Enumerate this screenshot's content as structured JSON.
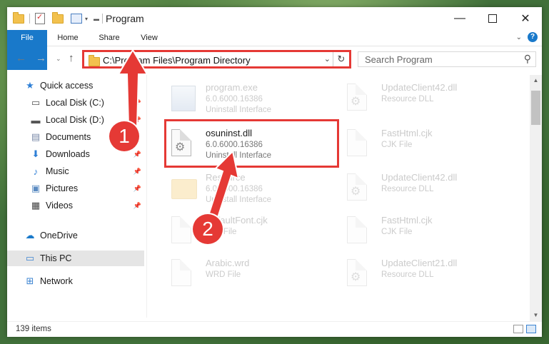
{
  "window": {
    "title": "Program"
  },
  "ribbon": {
    "tabs": [
      "File",
      "Home",
      "Share",
      "View"
    ],
    "help": "?"
  },
  "address": {
    "path": "C:\\Program Files\\Program Directory"
  },
  "search": {
    "placeholder": "Search Program"
  },
  "sidebar": {
    "items": [
      {
        "label": "Quick access",
        "icon": "star-icon"
      },
      {
        "label": "Local Disk (C:)",
        "icon": "drive-icon",
        "pinned": true
      },
      {
        "label": "Local Disk (D:)",
        "icon": "drive-icon",
        "pinned": true
      },
      {
        "label": "Documents",
        "icon": "documents-icon",
        "pinned": true
      },
      {
        "label": "Downloads",
        "icon": "download-icon",
        "pinned": true
      },
      {
        "label": "Music",
        "icon": "music-icon",
        "pinned": true
      },
      {
        "label": "Pictures",
        "icon": "pictures-icon",
        "pinned": true
      },
      {
        "label": "Videos",
        "icon": "videos-icon",
        "pinned": true
      },
      {
        "label": "OneDrive",
        "icon": "cloud-icon"
      },
      {
        "label": "This PC",
        "icon": "monitor-icon",
        "selected": true
      },
      {
        "label": "Network",
        "icon": "network-icon"
      }
    ]
  },
  "files": [
    {
      "name": "program.exe",
      "ver": "6.0.6000.16386",
      "desc": "Uninstall Interface",
      "kind": "exe",
      "faded": true
    },
    {
      "name": "UpdateClient42.dll",
      "ver": "Resource DLL",
      "desc": "",
      "kind": "dll",
      "faded": true
    },
    {
      "name": "osuninst.dll",
      "ver": "6.0.6000.16386",
      "desc": "Uninstall Interface",
      "kind": "dll",
      "faded": false
    },
    {
      "name": "FastHtml.cjk",
      "ver": "CJK File",
      "desc": "",
      "kind": "doc",
      "faded": true
    },
    {
      "name": "Resource",
      "ver": "6.0.6000.16386",
      "desc": "Uninstall Interface",
      "kind": "folder",
      "faded": true
    },
    {
      "name": "UpdateClient42.dll",
      "ver": "Resource DLL",
      "desc": "",
      "kind": "dll",
      "faded": true
    },
    {
      "name": "DefaultFont.cjk",
      "ver": "CJK File",
      "desc": "",
      "kind": "doc",
      "faded": true
    },
    {
      "name": "FastHtml.cjk",
      "ver": "CJK File",
      "desc": "",
      "kind": "doc",
      "faded": true
    },
    {
      "name": "Arabic.wrd",
      "ver": "WRD File",
      "desc": "",
      "kind": "doc",
      "faded": true
    },
    {
      "name": "UpdateClient21.dll",
      "ver": "Resource DLL",
      "desc": "",
      "kind": "dll",
      "faded": true
    }
  ],
  "status": {
    "count": "139 items"
  },
  "annotations": {
    "step1": "1",
    "step2": "2"
  },
  "colors": {
    "accent": "#1979ca",
    "highlight": "#e53935"
  }
}
